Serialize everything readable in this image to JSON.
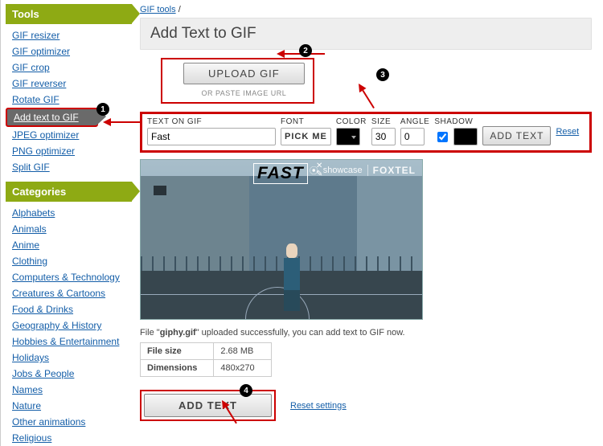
{
  "sidebar": {
    "tools_header": "Tools",
    "tools": [
      "GIF resizer",
      "GIF optimizer",
      "GIF crop",
      "GIF reverser",
      "Rotate GIF",
      "Add text to GIF",
      "JPEG optimizer",
      "PNG optimizer",
      "Split GIF"
    ],
    "tools_active_index": 5,
    "categories_header": "Categories",
    "categories": [
      "Alphabets",
      "Animals",
      "Anime",
      "Clothing",
      "Computers & Technology",
      "Creatures & Cartoons",
      "Food & Drinks",
      "Geography & History",
      "Hobbies & Entertainment",
      "Holidays",
      "Jobs & People",
      "Names",
      "Nature",
      "Other animations",
      "Religious"
    ]
  },
  "breadcrumb": {
    "link": "GIF tools",
    "sep": "/"
  },
  "header": {
    "title": "Add Text to GIF"
  },
  "upload": {
    "button": "UPLOAD GIF",
    "paste_hint": "OR PASTE IMAGE URL"
  },
  "panel": {
    "text_label": "TEXT ON GIF",
    "text_value": "Fast",
    "font_label": "FONT",
    "font_value": "PICK ME",
    "color_label": "COLOR",
    "size_label": "SIZE",
    "size_value": "30",
    "angle_label": "ANGLE",
    "angle_value": "0",
    "shadow_label": "SHADOW",
    "add_text_btn": "ADD TEXT",
    "reset": "Reset"
  },
  "preview": {
    "overlay_text": "FAST",
    "watermark1": "showcase",
    "watermark2": "FOXTEL"
  },
  "fileinfo": {
    "msg_prefix": "File \"",
    "filename": "giphy.gif",
    "msg_suffix": "\" uploaded successfully, you can add text to GIF now.",
    "rows": [
      {
        "k": "File size",
        "v": "2.68 MB"
      },
      {
        "k": "Dimensions",
        "v": "480x270"
      }
    ]
  },
  "actions": {
    "add_text": "ADD TEXT",
    "reset_settings": "Reset settings"
  },
  "annotations": {
    "n1": "1",
    "n2": "2",
    "n3": "3",
    "n4": "4"
  }
}
